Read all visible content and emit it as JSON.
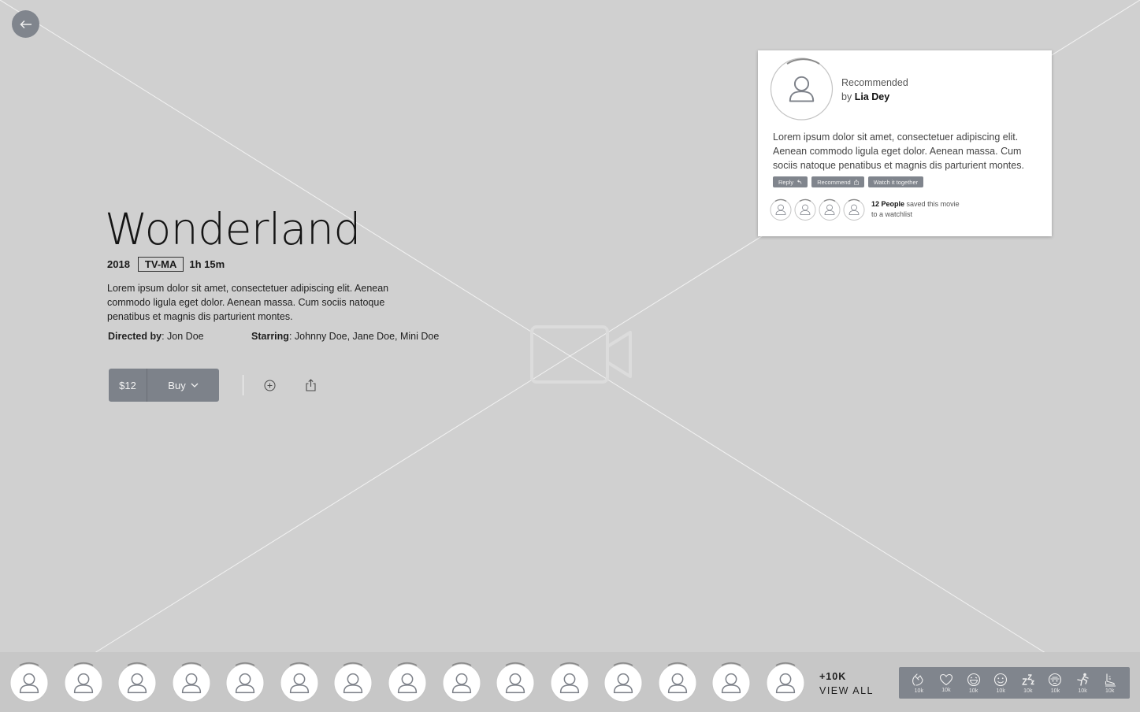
{
  "movie": {
    "title": "Wonderland",
    "year": "2018",
    "rating": "TV-MA",
    "duration": "1h 15m",
    "description": "Lorem ipsum dolor sit amet, consectetuer adipiscing elit. Aenean commodo ligula eget dolor. Aenean massa. Cum sociis natoque penatibus et magnis dis parturient montes.",
    "directed_label": "Directed by",
    "director": ": Jon Doe",
    "starring_label": "Starring",
    "cast": ": Johnny Doe, Jane Doe, Mini Doe"
  },
  "purchase": {
    "price": "$12",
    "buy_label": "Buy"
  },
  "icons": {
    "back": "arrow-left-icon",
    "add": "plus-circle-icon",
    "share": "share-icon",
    "video": "video-camera-icon",
    "avatar": "user-icon"
  },
  "recommendation": {
    "label": "Recommended",
    "by_prefix": "by",
    "recommender": "Lia Dey",
    "message": "Lorem ipsum dolor sit amet, consectetuer adipiscing elit. Aenean commodo ligula eget dolor. Aenean massa. Cum sociis natoque penatibus et magnis dis parturient montes.",
    "actions": {
      "reply": "Reply",
      "recommend": "Recommend",
      "watch": "Watch it together"
    },
    "saved_count": "12 People",
    "saved_text": "saved this movie",
    "saved_text2": "to a watchlist"
  },
  "friends": {
    "more_count": "+10K",
    "view_all": "VIEW ALL"
  },
  "reactions": [
    {
      "icon": "clap-icon",
      "count": "10k"
    },
    {
      "icon": "heart-icon",
      "count": "10k"
    },
    {
      "icon": "laugh-icon",
      "count": "10k"
    },
    {
      "icon": "wink-icon",
      "count": "10k"
    },
    {
      "icon": "sleep-icon",
      "count": "10k"
    },
    {
      "icon": "monkey-icon",
      "count": "10k"
    },
    {
      "icon": "kick-icon",
      "count": "10k"
    },
    {
      "icon": "skate-icon",
      "count": "10k"
    }
  ],
  "colors": {
    "background": "#d0d0d0",
    "button_gray": "#80858d",
    "card": "#ffffff",
    "bottom_bar": "#c7c7c7"
  }
}
